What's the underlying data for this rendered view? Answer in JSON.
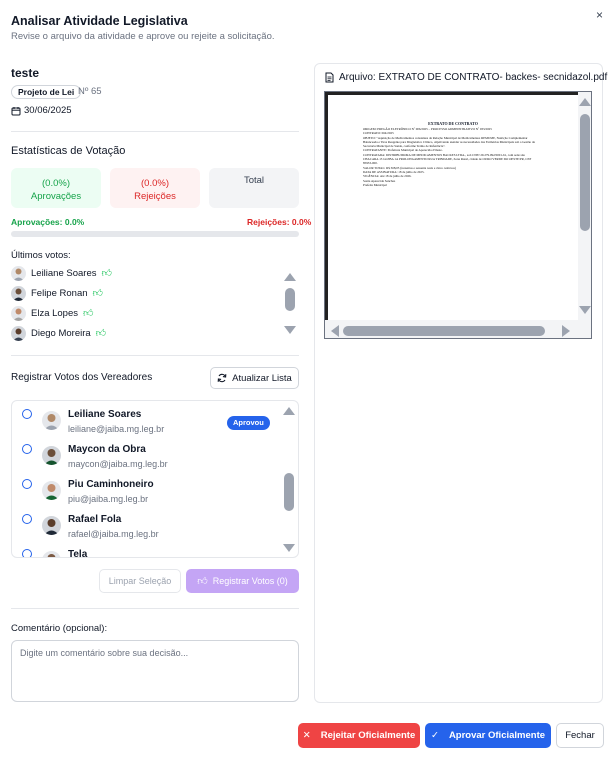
{
  "header": {
    "title": "Analisar Atividade Legislativa",
    "subtitle": "Revise o arquivo da atividade e aprove ou rejeite a solicitação.",
    "close_symbol": "×"
  },
  "activity": {
    "name": "teste",
    "type": "Projeto de Lei",
    "number": "Nº 65",
    "date": "30/06/2025"
  },
  "stats": {
    "title": "Estatísticas de Votação",
    "approve_pct": "(0.0%)",
    "approve_label": "Aprovações",
    "reject_pct": "(0.0%)",
    "reject_label": "Rejeições",
    "total_label": "Total",
    "approve_summary": "Aprovações: 0.0%",
    "reject_summary": "Rejeições: 0.0%",
    "approve_fraction": 0.0
  },
  "last_votes": {
    "label": "Últimos votos:",
    "items": [
      {
        "name": "Leiliane Soares",
        "vote": "thumbs-up-icon"
      },
      {
        "name": "Felipe Ronan",
        "vote": "thumbs-up-icon"
      },
      {
        "name": "Elza Lopes",
        "vote": "thumbs-up-icon"
      },
      {
        "name": "Diego Moreira",
        "vote": "thumbs-up-icon"
      }
    ]
  },
  "register": {
    "title": "Registrar Votos dos Vereadores",
    "refresh_label": "Atualizar Lista",
    "councilors": [
      {
        "name": "Leiliane Soares",
        "email": "leiliane@jaiba.mg.leg.br",
        "badge": "Aprovou"
      },
      {
        "name": "Maycon da Obra",
        "email": "maycon@jaiba.mg.leg.br",
        "badge": ""
      },
      {
        "name": "Piu Caminhoneiro",
        "email": "piu@jaiba.mg.leg.br",
        "badge": ""
      },
      {
        "name": "Rafael Fola",
        "email": "rafael@jaiba.mg.leg.br",
        "badge": ""
      },
      {
        "name": "Tela",
        "email": "",
        "badge": ""
      }
    ],
    "clear_label": "Limpar Seleção",
    "register_label": "Registrar Votos (0)"
  },
  "comment": {
    "label": "Comentário (opcional):",
    "placeholder": "Digite um comentário sobre sua decisão..."
  },
  "document": {
    "title": "Arquivo: EXTRATO DE CONTRATO- backes- secnidazol.pdf",
    "heading": "EXTRATO DE CONTRATO",
    "lines": [
      "ORIGEM: PREGÃO ELETRÔNICO Nº 006/2025 – PROCESSO ADMINISTRATIVO Nº 033/2025",
      "CONTRATO: 064/2025",
      "OBJETO: \"Aquisição de Medicamentos constantes da Relação Municipal de Medicamentos REMUME, Nutrição Complementar Balanceada e Tiras Reagente para Diagnóstico Clínico, objetivando atender as necessidades das Farmácias Municipais sob a Gestão da Secretaria Municipal de Saúde, conforme Termo de Referência\".",
      "CONTRATANTE: Prefeitura Municipal de Aparecida d'Oeste.",
      "CONTRATADA: DISTRIBUIDORA DE MEDICAMENTOS BACKES LTDA., sob CNPJ 29.279.092/0001-61, com sede sito CHACARA 13 GLEBA 1A PROLONGAMENTO RUA TRINDADE, Zona Rural, cidade de OURO VERDE DO OESTE/PR, CEP 85933-000.",
      "VALOR TOTAL: R$ 368,05 (trezentos e sessenta reais e cinco centavos)",
      "DATA DE ASSINATURA: 18 de julho de 2025.",
      "VIGÊNCIA: Até 18 de julho de 2026.",
      "Sonia Aparecida Sanches",
      "Prefeita Municipal"
    ]
  },
  "footer": {
    "reject_label": "Rejeitar Oficialmente",
    "approve_label": "Aprovar Oficialmente",
    "close_label": "Fechar"
  },
  "colors": {
    "primary": "#2563eb",
    "danger": "#ef4444",
    "success": "#16a34a",
    "accent_disabled": "#c4a5f5"
  }
}
